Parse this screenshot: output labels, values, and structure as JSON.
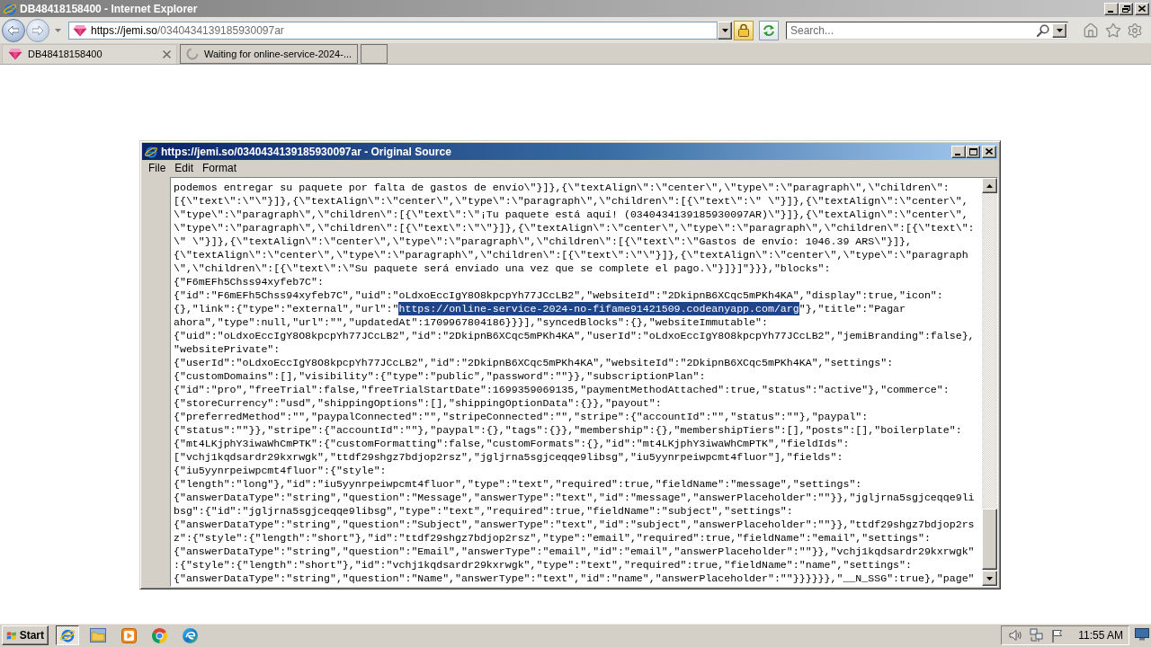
{
  "browser": {
    "title": "DB48418158400 - Internet Explorer",
    "address": {
      "host": "https://jemi.so",
      "path": "/0340434139185930097ar"
    },
    "search": {
      "placeholder": "Search..."
    }
  },
  "tabs": [
    {
      "label": "DB48418158400",
      "selected": true,
      "kind": "page"
    },
    {
      "label": "Waiting for online-service-2024-...",
      "selected": false,
      "kind": "loading"
    }
  ],
  "source_window": {
    "title": "https://jemi.so/0340434139185930097ar - Original Source",
    "menu": [
      "File",
      "Edit",
      "Format"
    ],
    "lines": [
      "podemos entregar su paquete por falta de gastos de envío\\\"}]},{\\\"textAlign\\\":\\\"center\\\",\\\"type\\\":\\\"paragraph\\\",\\\"children\\\":",
      "[{\\\"text\\\":\\\"\\\"}]},{\\\"textAlign\\\":\\\"center\\\",\\\"type\\\":\\\"paragraph\\\",\\\"children\\\":[{\\\"text\\\":\\\" \\\"}]},{\\\"textAlign\\\":\\\"center\\\",",
      "\\\"type\\\":\\\"paragraph\\\",\\\"children\\\":[{\\\"text\\\":\\\"¡Tu paquete está aquí! (0340434139185930097AR)\\\"}]},{\\\"textAlign\\\":\\\"center\\\",",
      "\\\"type\\\":\\\"paragraph\\\",\\\"children\\\":[{\\\"text\\\":\\\"\\\"}]},{\\\"textAlign\\\":\\\"center\\\",\\\"type\\\":\\\"paragraph\\\",\\\"children\\\":[{\\\"text\\\":",
      "\\\" \\\"}]},{\\\"textAlign\\\":\\\"center\\\",\\\"type\\\":\\\"paragraph\\\",\\\"children\\\":[{\\\"text\\\":\\\"Gastos de envío: 1046.39 ARS\\\"}]},",
      "{\\\"textAlign\\\":\\\"center\\\",\\\"type\\\":\\\"paragraph\\\",\\\"children\\\":[{\\\"text\\\":\\\"\\\"}]},{\\\"textAlign\\\":\\\"center\\\",\\\"type\\\":\\\"paragraph",
      "\\\",\\\"children\\\":[{\\\"text\\\":\\\"Su paquete será enviado una vez que se complete el pago.\\\"}]}]\"}}},\"blocks\":",
      "{\"F6mEFh5Chss94xyfeb7C\":",
      "{\"id\":\"F6mEFh5Chss94xyfeb7C\",\"uid\":\"oLdxoEccIgY8O8kpcpYh77JCcLB2\",\"websiteId\":\"2DkipnB6XCqc5mPKh4KA\",\"display\":true,\"icon\":",
      {
        "parts": [
          {
            "text": "{},\"link\":{\"type\":\"external\",\"url\":\"",
            "selected": false
          },
          {
            "text": "https://online-service-2024-no-fifame91421509.codeanyapp.com/arg",
            "selected": true
          },
          {
            "text": "\"},\"title\":\"Pagar",
            "selected": false
          }
        ]
      },
      "ahora\",\"type\":null,\"url\":\"\",\"updatedAt\":1709967804186}}}],\"syncedBlocks\":{},\"websiteImmutable\":",
      "{\"uid\":\"oLdxoEccIgY8O8kpcpYh77JCcLB2\",\"id\":\"2DkipnB6XCqc5mPKh4KA\",\"userId\":\"oLdxoEccIgY8O8kpcpYh77JCcLB2\",\"jemiBranding\":false},",
      "\"websitePrivate\":",
      "{\"userId\":\"oLdxoEccIgY8O8kpcpYh77JCcLB2\",\"id\":\"2DkipnB6XCqc5mPKh4KA\",\"websiteId\":\"2DkipnB6XCqc5mPKh4KA\",\"settings\":",
      "{\"customDomains\":[],\"visibility\":{\"type\":\"public\",\"password\":\"\"}},\"subscriptionPlan\":",
      "{\"id\":\"pro\",\"freeTrial\":false,\"freeTrialStartDate\":1699359069135,\"paymentMethodAttached\":true,\"status\":\"active\"},\"commerce\":",
      "{\"storeCurrency\":\"usd\",\"shippingOptions\":[],\"shippingOptionData\":{}},\"payout\":",
      "{\"preferredMethod\":\"\",\"paypalConnected\":\"\",\"stripeConnected\":\"\",\"stripe\":{\"accountId\":\"\",\"status\":\"\"},\"paypal\":",
      "{\"status\":\"\"}},\"stripe\":{\"accountId\":\"\"},\"paypal\":{},\"tags\":{}},\"membership\":{},\"membershipTiers\":[],\"posts\":[],\"boilerplate\":",
      "{\"mt4LKjphY3iwaWhCmPTK\":{\"customFormatting\":false,\"customFormats\":{},\"id\":\"mt4LKjphY3iwaWhCmPTK\",\"fieldIds\":",
      "[\"vchj1kqdsardr29kxrwgk\",\"ttdf29shgz7bdjop2rsz\",\"jgljrna5sgjceqqe9libsg\",\"iu5yynrpeiwpcmt4fluor\"],\"fields\":",
      "{\"iu5yynrpeiwpcmt4fluor\":{\"style\":",
      "{\"length\":\"long\"},\"id\":\"iu5yynrpeiwpcmt4fluor\",\"type\":\"text\",\"required\":true,\"fieldName\":\"message\",\"settings\":",
      "{\"answerDataType\":\"string\",\"question\":\"Message\",\"answerType\":\"text\",\"id\":\"message\",\"answerPlaceholder\":\"\"}},\"jgljrna5sgjceqqe9li",
      "bsg\":{\"id\":\"jgljrna5sgjceqqe9libsg\",\"type\":\"text\",\"required\":true,\"fieldName\":\"subject\",\"settings\":",
      "{\"answerDataType\":\"string\",\"question\":\"Subject\",\"answerType\":\"text\",\"id\":\"subject\",\"answerPlaceholder\":\"\"}},\"ttdf29shgz7bdjop2rs",
      "z\":{\"style\":{\"length\":\"short\"},\"id\":\"ttdf29shgz7bdjop2rsz\",\"type\":\"email\",\"required\":true,\"fieldName\":\"email\",\"settings\":",
      "{\"answerDataType\":\"string\",\"question\":\"Email\",\"answerType\":\"email\",\"id\":\"email\",\"answerPlaceholder\":\"\"}},\"vchj1kqdsardr29kxrwgk\"",
      ":{\"style\":{\"length\":\"short\"},\"id\":\"vchj1kqdsardr29kxrwgk\",\"type\":\"text\",\"required\":true,\"fieldName\":\"name\",\"settings\":",
      "{\"answerDataType\":\"string\",\"question\":\"Name\",\"answerType\":\"text\",\"id\":\"name\",\"answerPlaceholder\":\"\"}}}}}},\"__N_SSG\":true},\"page\""
    ]
  },
  "taskbar": {
    "start": "Start",
    "apps": [
      {
        "kind": "ie",
        "selected": true
      },
      {
        "kind": "folder",
        "selected": false
      },
      {
        "kind": "media",
        "selected": false
      },
      {
        "kind": "chrome",
        "selected": false
      },
      {
        "kind": "edge",
        "selected": false
      }
    ],
    "clock": "11:55 AM"
  }
}
